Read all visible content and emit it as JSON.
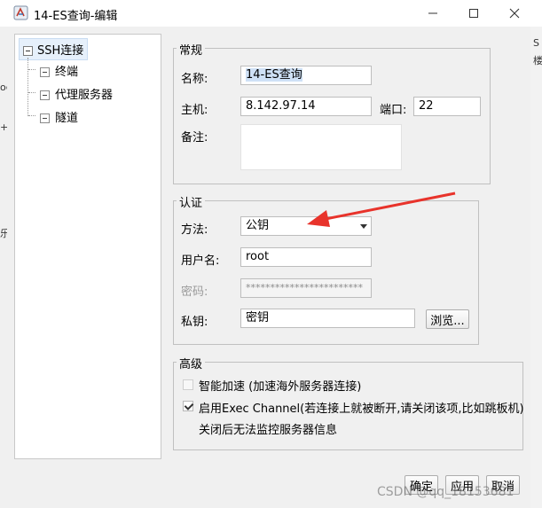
{
  "window": {
    "title": "14-ES查询-编辑"
  },
  "tree": {
    "root": "SSH连接",
    "children": [
      "终端",
      "代理服务器",
      "隧道"
    ]
  },
  "general": {
    "section_title": "常规",
    "name_label": "名称:",
    "name_value": "14-ES查询",
    "host_label": "主机:",
    "host_value": "8.142.97.14",
    "port_label": "端口:",
    "port_value": "22",
    "notes_label": "备注:"
  },
  "auth": {
    "section_title": "认证",
    "method_label": "方法:",
    "method_value": "公钥",
    "username_label": "用户名:",
    "username_value": "root",
    "password_label": "密码:",
    "password_value": "************************",
    "key_label": "私钥:",
    "key_value": "密钥",
    "browse_label": "浏览..."
  },
  "advanced": {
    "section_title": "高级",
    "smart_accel_label": "智能加速 (加速海外服务器连接)",
    "smart_accel_checked": false,
    "exec_channel_label": "启用Exec Channel(若连接上就被断开,请关闭该项,比如跳板机)",
    "exec_channel_note": "关闭后无法监控服务器信息",
    "exec_channel_checked": true
  },
  "footer": {
    "ok_label": "确定",
    "apply_label": "应用",
    "cancel_label": "取消"
  },
  "watermark": "CSDN @qq_18153681",
  "background": {
    "right_fragments": [
      "S",
      "楼"
    ],
    "left_fragments": [
      "oc",
      "+",
      "乐"
    ]
  },
  "colors": {
    "annotation_arrow": "#e8332b",
    "selection": "#cfe1f6"
  }
}
